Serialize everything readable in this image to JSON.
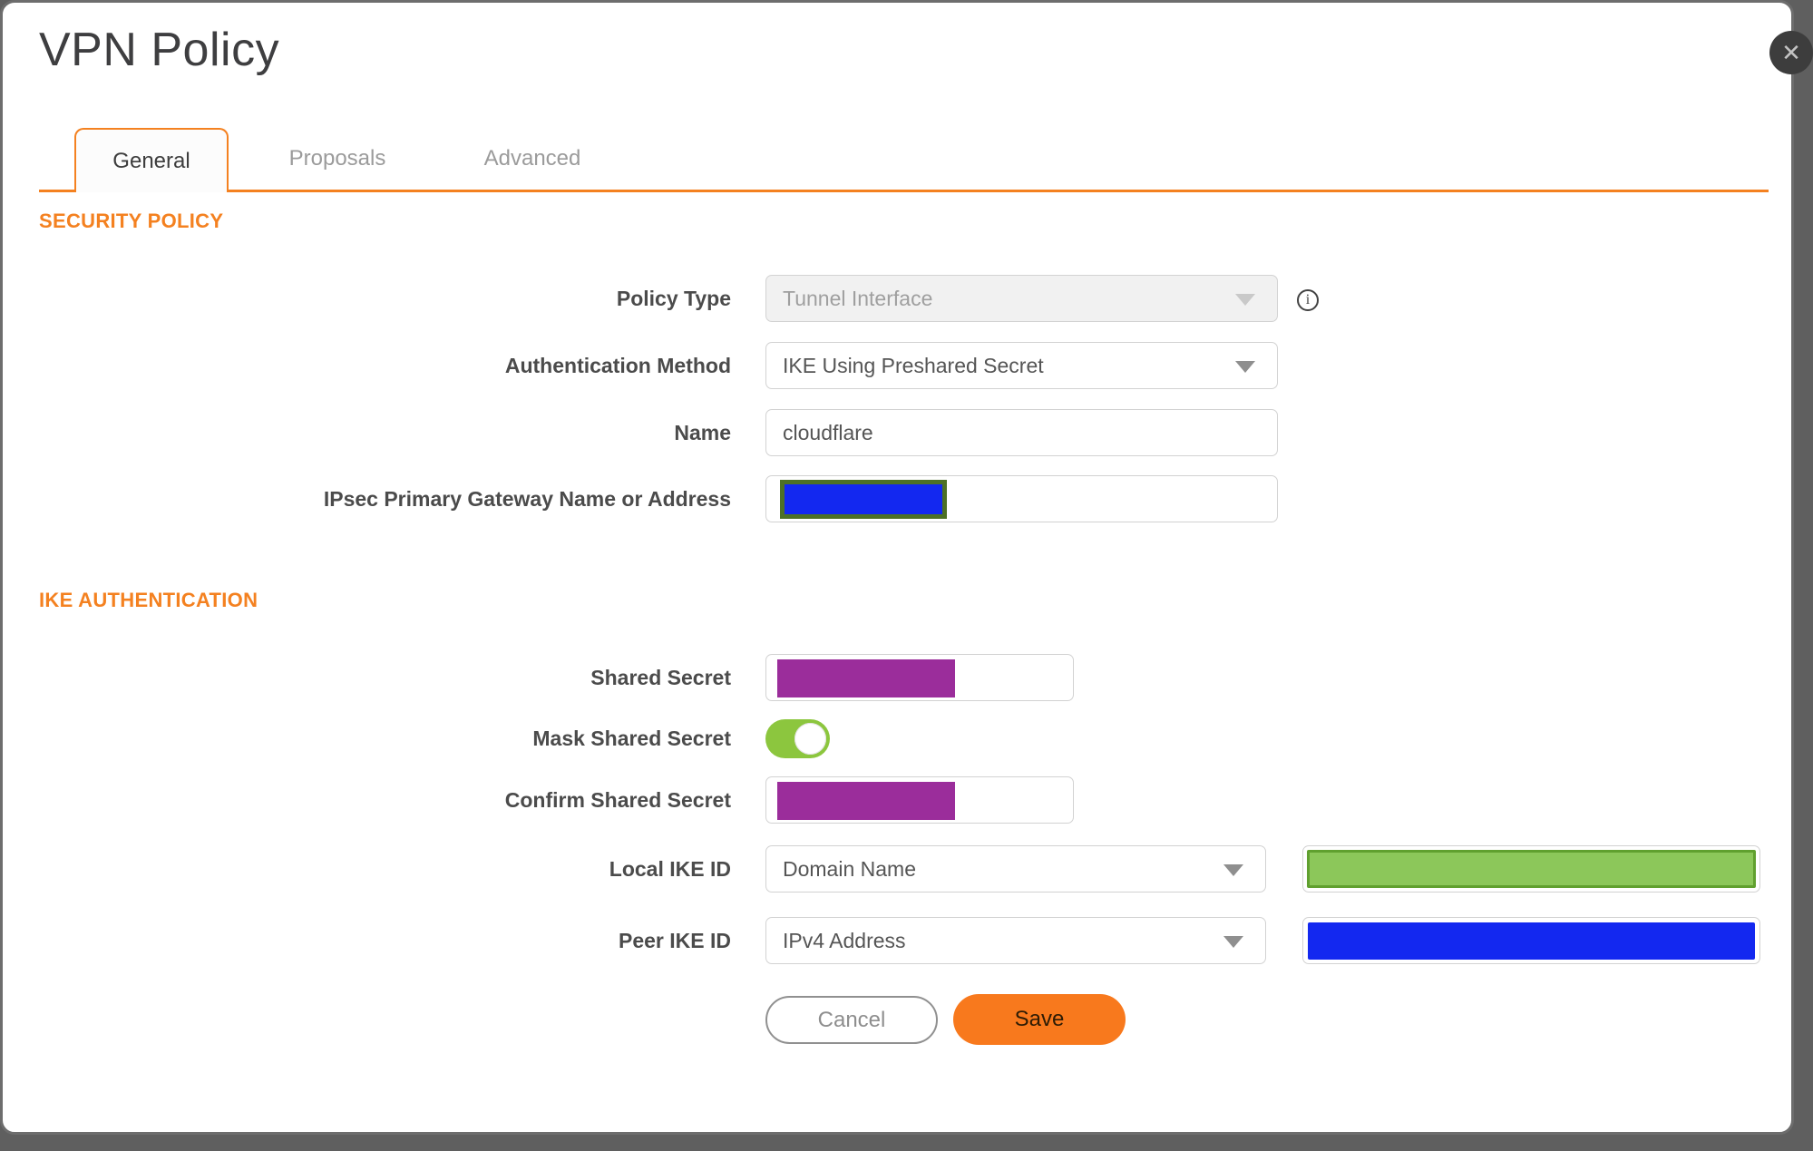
{
  "dialog": {
    "title": "VPN Policy",
    "close_icon": "✕"
  },
  "tabs": [
    {
      "label": "General",
      "active": true
    },
    {
      "label": "Proposals",
      "active": false
    },
    {
      "label": "Advanced",
      "active": false
    }
  ],
  "sections": {
    "security": {
      "heading": "SECURITY POLICY"
    },
    "ike": {
      "heading": "IKE AUTHENTICATION"
    }
  },
  "fields": {
    "policy_type": {
      "label": "Policy Type",
      "value": "Tunnel Interface",
      "disabled": true
    },
    "auth_method": {
      "label": "Authentication Method",
      "value": "IKE Using Preshared Secret"
    },
    "name": {
      "label": "Name",
      "value": "cloudflare"
    },
    "gateway": {
      "label": "IPsec Primary Gateway Name or Address",
      "value_redacted": true
    },
    "shared_secret": {
      "label": "Shared Secret",
      "value_redacted": true
    },
    "mask_shared_secret": {
      "label": "Mask Shared Secret",
      "toggle_state": "on"
    },
    "confirm_shared_secret": {
      "label": "Confirm Shared Secret",
      "value_redacted": true
    },
    "local_ike_id": {
      "label": "Local IKE ID",
      "value": "Domain Name",
      "side_value_redacted": true
    },
    "peer_ike_id": {
      "label": "Peer IKE ID",
      "value": "IPv4 Address",
      "side_value_redacted": true
    }
  },
  "icons": {
    "info": "i"
  },
  "buttons": {
    "cancel": "Cancel",
    "save": "Save"
  },
  "colors": {
    "accent_orange": "#f48120",
    "save_button_orange": "#f8791d",
    "toggle_green": "#8cc63e",
    "redaction_purple": "#9b2d9b",
    "redaction_blue": "#1328f0",
    "redaction_green_fill": "#8cc75a",
    "redaction_green_border": "#60a02f",
    "redaction_olive_border": "#4d7026",
    "label_gray": "#4b4b4b",
    "overlay_backdrop_gray": "#5f5f5f"
  }
}
